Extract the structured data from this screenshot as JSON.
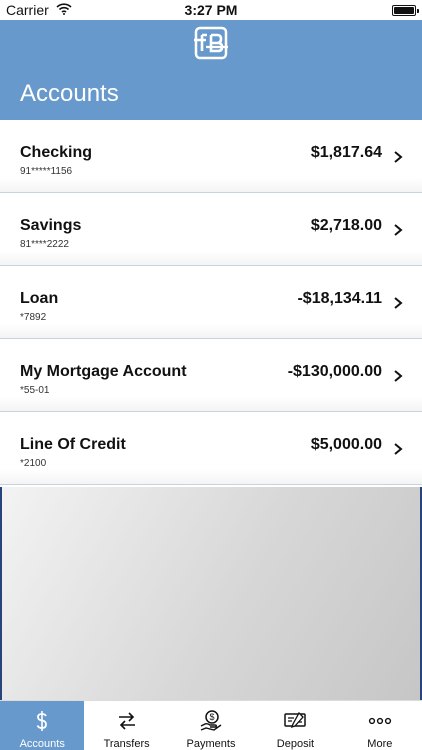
{
  "status_bar": {
    "carrier": "Carrier",
    "time": "3:27 PM"
  },
  "header": {
    "title": "Accounts",
    "logo_icon": "fb-logo-icon"
  },
  "accounts": [
    {
      "name": "Checking",
      "number": "91*****1156",
      "balance": "$1,817.64"
    },
    {
      "name": "Savings",
      "number": "81****2222",
      "balance": "$2,718.00"
    },
    {
      "name": "Loan",
      "number": "*7892",
      "balance": "-$18,134.11"
    },
    {
      "name": "My Mortgage Account",
      "number": "*55-01",
      "balance": "-$130,000.00"
    },
    {
      "name": "Line Of Credit",
      "number": "*2100",
      "balance": "$5,000.00"
    }
  ],
  "tab_bar": {
    "tabs": [
      {
        "label": "Accounts",
        "icon": "dollar-icon",
        "active": true
      },
      {
        "label": "Transfers",
        "icon": "transfer-arrows-icon",
        "active": false
      },
      {
        "label": "Payments",
        "icon": "payment-hand-icon",
        "active": false
      },
      {
        "label": "Deposit",
        "icon": "check-deposit-icon",
        "active": false
      },
      {
        "label": "More",
        "icon": "more-dots-icon",
        "active": false
      }
    ]
  },
  "colors": {
    "header_blue": "#6899cc",
    "active_tab": "#6899cc",
    "row_divider": "#c8d3e2",
    "panel_border": "#27457a"
  }
}
